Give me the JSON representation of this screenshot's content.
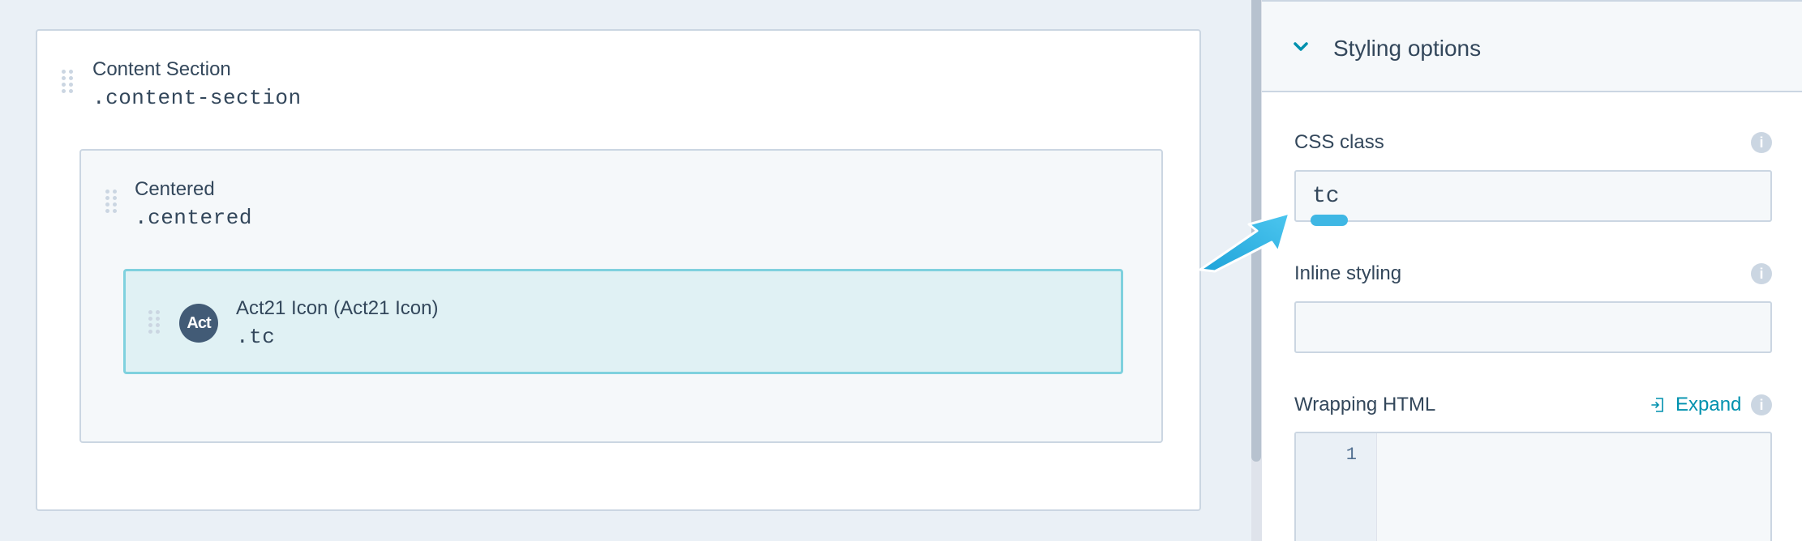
{
  "canvas": {
    "section": {
      "title": "Content Section",
      "class_name": ".content-section"
    },
    "centered": {
      "title": "Centered",
      "class_name": ".centered"
    },
    "icon_module": {
      "avatar_text": "Act",
      "title": "Act21 Icon (Act21 Icon)",
      "class_name": ".tc"
    }
  },
  "panel": {
    "header_title": "Styling options",
    "css_class": {
      "label": "CSS class",
      "value": "tc",
      "info": "i"
    },
    "inline_styling": {
      "label": "Inline styling",
      "value": "",
      "info": "i"
    },
    "wrapping_html": {
      "label": "Wrapping HTML",
      "expand_label": "Expand",
      "info": "i",
      "line_number": "1"
    }
  },
  "colors": {
    "accent": "#0091ae",
    "selected_border": "#7fd1de",
    "selected_bg": "#e0f1f4",
    "arrow": "#3fb7e4",
    "avatar_bg": "#425b76"
  },
  "icons": [
    "drag-handle-icon",
    "chevron-down-icon",
    "info-icon",
    "expand-icon",
    "pointer-arrow-icon"
  ]
}
